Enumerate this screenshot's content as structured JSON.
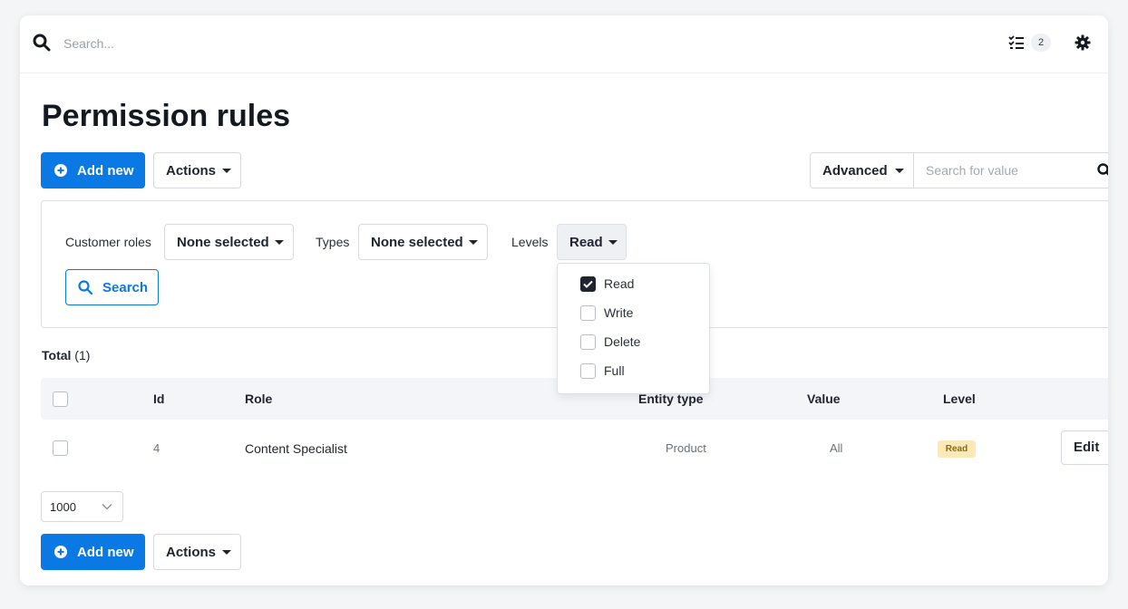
{
  "topbar": {
    "search_placeholder": "Search...",
    "tasks_count": "2"
  },
  "page": {
    "title": "Permission rules"
  },
  "toolbar": {
    "add_new": "Add new",
    "actions": "Actions"
  },
  "advanced": {
    "label": "Advanced",
    "placeholder": "Search for value"
  },
  "filters": {
    "customer_roles_label": "Customer roles",
    "customer_roles_value": "None selected",
    "types_label": "Types",
    "types_value": "None selected",
    "levels_label": "Levels",
    "levels_value": "Read",
    "search_button": "Search"
  },
  "levels_dropdown": {
    "options": [
      {
        "label": "Read",
        "checked": true
      },
      {
        "label": "Write",
        "checked": false
      },
      {
        "label": "Delete",
        "checked": false
      },
      {
        "label": "Full",
        "checked": false
      }
    ]
  },
  "total": {
    "label": "Total",
    "count": "(1)"
  },
  "table": {
    "columns": [
      "Id",
      "Role",
      "Entity type",
      "Value",
      "Level"
    ],
    "rows": [
      {
        "id": "4",
        "role": "Content Specialist",
        "entity_type": "Product",
        "value": "All",
        "level": "Read",
        "action": "Edit"
      }
    ]
  },
  "pager": {
    "page_size": "1000"
  },
  "colors": {
    "accent": "#0b79e4",
    "badge_bg": "#fde9b8"
  },
  "icons": [
    "search-icon",
    "tasks-icon",
    "gear-icon",
    "plus-circle-icon",
    "caret-down-icon",
    "chevron-down-icon",
    "check-icon"
  ]
}
